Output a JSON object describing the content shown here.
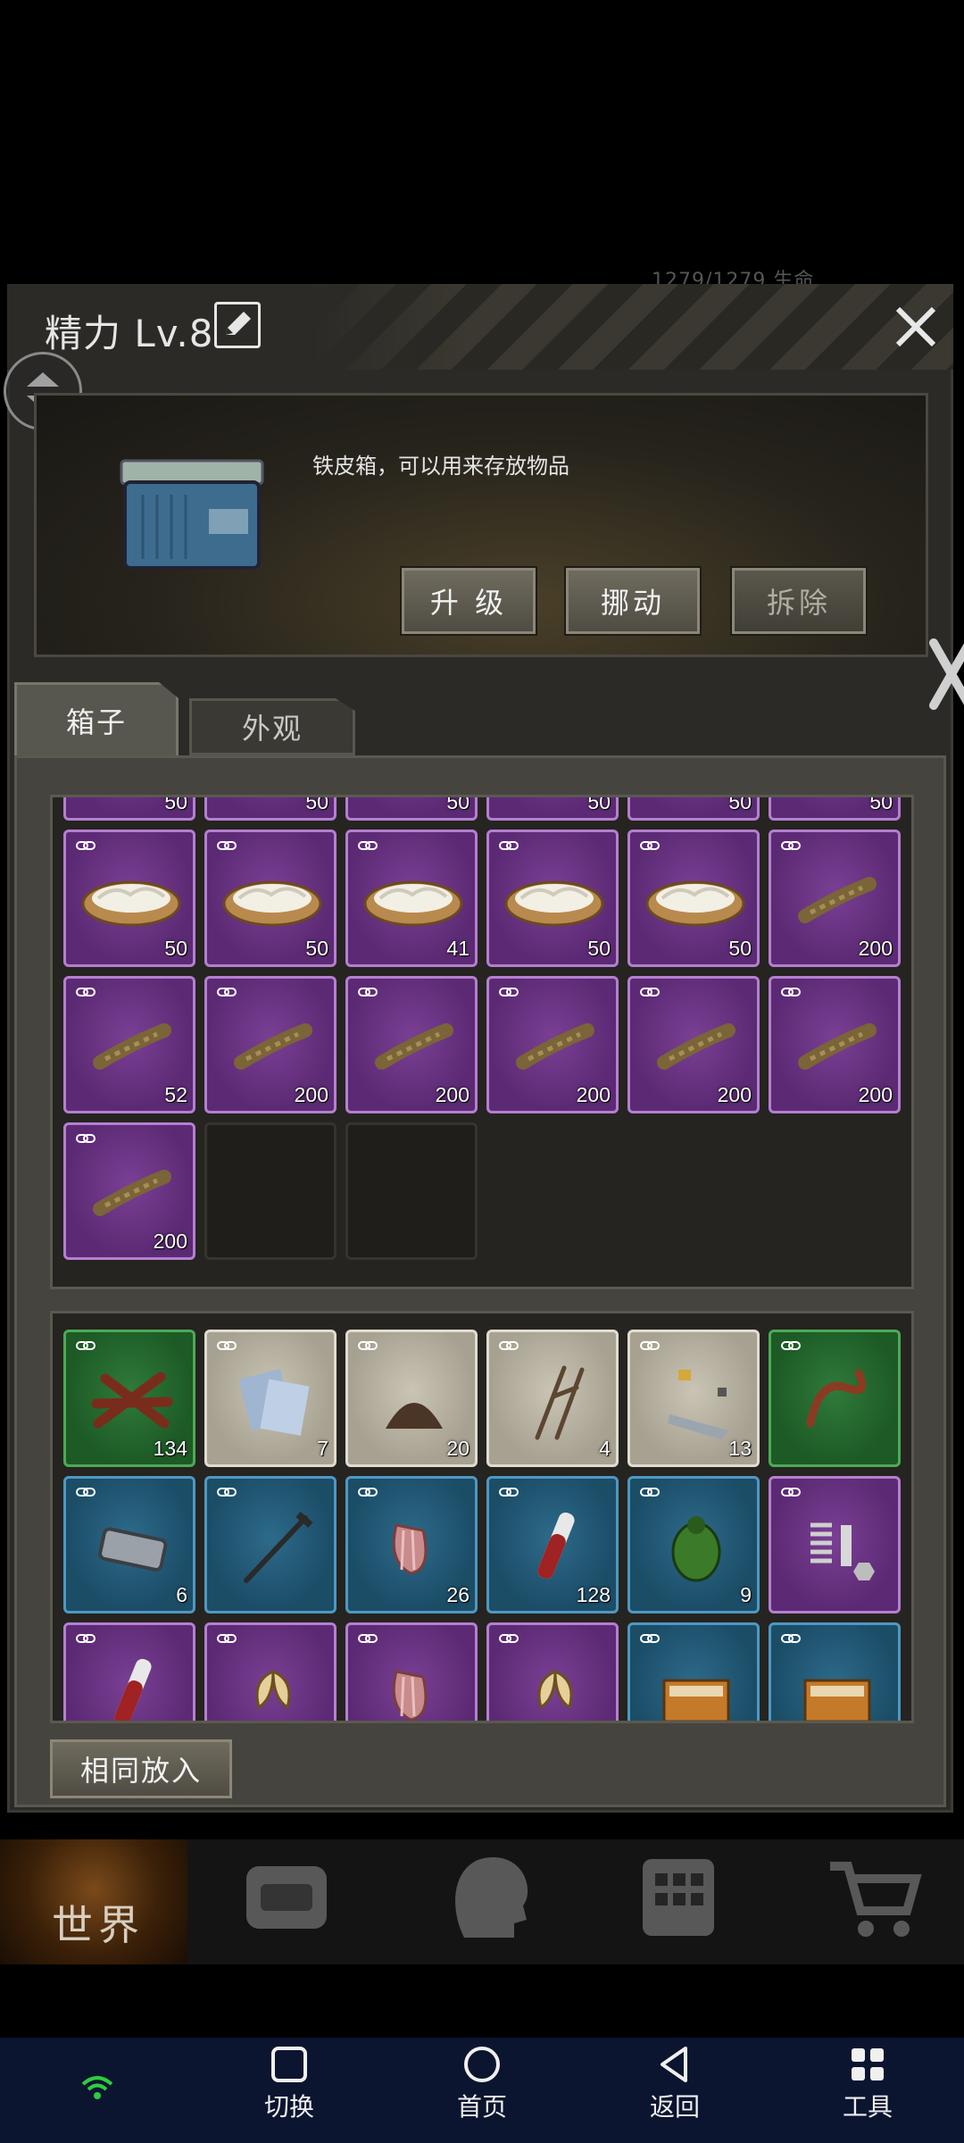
{
  "header": {
    "title": "精力 Lv.8",
    "hud_text": "1279/1279  生命"
  },
  "info": {
    "description": "铁皮箱，可以用来存放物品",
    "buttons": {
      "upgrade": "升 级",
      "move": "挪动",
      "dismantle": "拆除"
    }
  },
  "tabs": {
    "box": "箱子",
    "appearance": "外观"
  },
  "storage": {
    "rows": [
      [
        "50",
        "50",
        "50",
        "50",
        "50",
        "50"
      ],
      [
        "50",
        "50",
        "41",
        "50",
        "50",
        "200"
      ],
      [
        "52",
        "200",
        "200",
        "200",
        "200",
        "200"
      ],
      [
        "200",
        "",
        ""
      ]
    ]
  },
  "inventory": {
    "rows": [
      [
        "134",
        "7",
        "20",
        "4",
        "13",
        ""
      ],
      [
        "6",
        "",
        "26",
        "128",
        "9",
        ""
      ],
      [
        "",
        "",
        "",
        "",
        "",
        ""
      ]
    ]
  },
  "same_put_label": "相同放入",
  "game_nav": {
    "world": "世界"
  },
  "sys_nav": {
    "switch": "切换",
    "home": "首页",
    "back": "返回",
    "tools": "工具"
  },
  "colors": {
    "rare_purple": "#5c2a74",
    "uncommon_green": "#1d5a26",
    "magic_blue": "#1b4d67",
    "common_white": "#a7a191"
  }
}
